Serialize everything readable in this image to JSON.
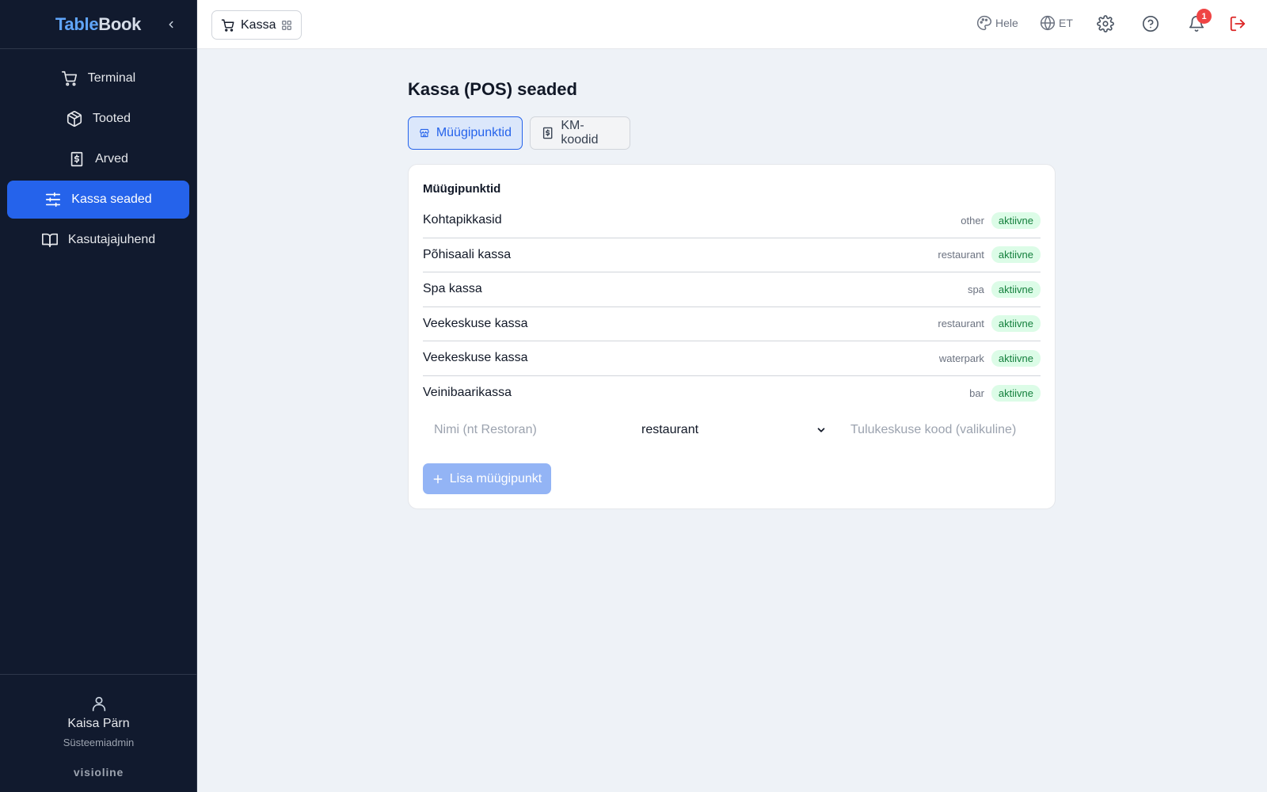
{
  "brand": {
    "part1": "Table",
    "part2": "Book"
  },
  "sidebar": {
    "items": [
      {
        "label": "Terminal",
        "icon": "cart-icon"
      },
      {
        "label": "Tooted",
        "icon": "box-icon"
      },
      {
        "label": "Arved",
        "icon": "invoice-icon"
      },
      {
        "label": "Kassa seaded",
        "icon": "sliders-icon",
        "active": true
      },
      {
        "label": "Kasutajajuhend",
        "icon": "book-icon"
      }
    ],
    "user": {
      "name": "Kaisa Pärn",
      "role": "Süsteemiadmin"
    },
    "footer_brand": "visioline"
  },
  "topbar": {
    "module_label": "Kassa",
    "theme_label": "Hele",
    "language_label": "ET",
    "notification_count": "1"
  },
  "main": {
    "title": "Kassa (POS) seaded",
    "tabs": [
      {
        "label": "Müügipunktid",
        "active": true
      },
      {
        "label": "KM-koodid",
        "active": false
      }
    ],
    "card": {
      "title": "Müügipunktid",
      "rows": [
        {
          "name": "Kohtapikkasid",
          "type": "other",
          "status": "aktiivne"
        },
        {
          "name": "Põhisaali kassa",
          "type": "restaurant",
          "status": "aktiivne"
        },
        {
          "name": "Spa kassa",
          "type": "spa",
          "status": "aktiivne"
        },
        {
          "name": "Veekeskuse kassa",
          "type": "restaurant",
          "status": "aktiivne"
        },
        {
          "name": "Veekeskuse kassa",
          "type": "waterpark",
          "status": "aktiivne"
        },
        {
          "name": "Veinibaarikassa",
          "type": "bar",
          "status": "aktiivne"
        }
      ],
      "form": {
        "name_placeholder": "Nimi (nt Restoran)",
        "name_value": "",
        "type_selected": "restaurant",
        "cost_center_placeholder": "Tulukeskuse kood (valikuline)",
        "cost_center_value": "",
        "add_button_label": "Lisa müügipunkt"
      }
    }
  },
  "colors": {
    "sidebar_bg": "#111a2e",
    "accent": "#2563eb",
    "active_badge_bg": "#dcfce7",
    "active_badge_text": "#15803d",
    "logout": "#dc2626",
    "notification": "#ef4444"
  }
}
